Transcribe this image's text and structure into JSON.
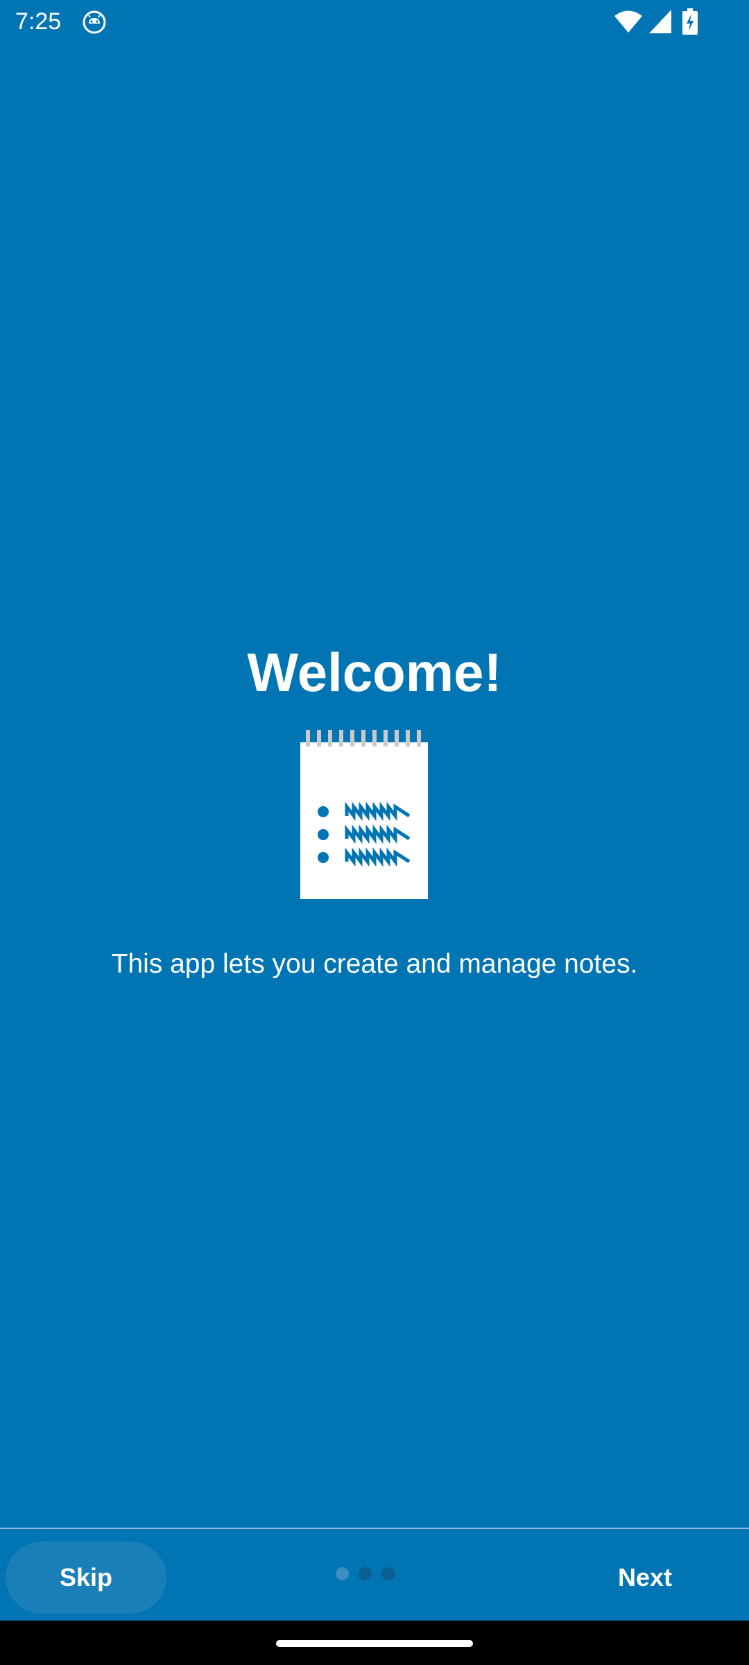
{
  "status_bar": {
    "time": "7:25",
    "icons": [
      "app-notification-icon",
      "wifi-icon",
      "signal-icon",
      "battery-charging-icon"
    ]
  },
  "onboarding": {
    "title": "Welcome!",
    "message": "This app lets you create and manage notes.",
    "illustration": "notepad-icon",
    "page_count": 3,
    "current_page": 1
  },
  "actions": {
    "skip_label": "Skip",
    "next_label": "Next"
  },
  "colors": {
    "background": "#0174b3",
    "text": "#ffffff",
    "dot_active": "#3d8fc3",
    "dot_inactive": "#0b5e92"
  }
}
